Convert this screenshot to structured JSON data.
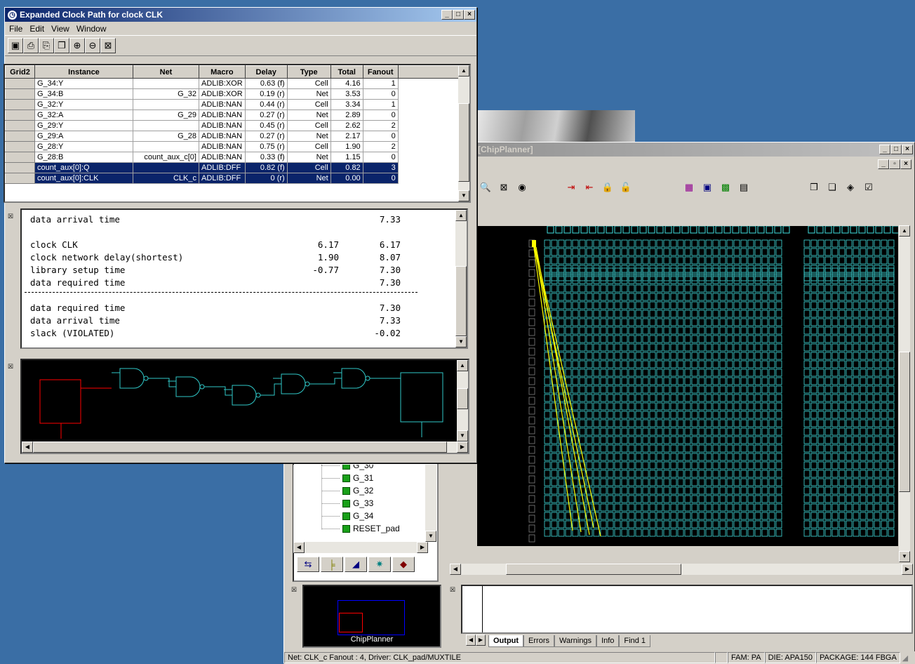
{
  "timing_window": {
    "title": "Expanded Clock Path for clock CLK",
    "menu": [
      "File",
      "Edit",
      "View",
      "Window"
    ],
    "toolbar_icons": [
      "save-icon",
      "print-icon",
      "print-preview-icon",
      "copy-icon",
      "zoom-in-icon",
      "zoom-out-icon",
      "zoom-fit-icon"
    ],
    "columns": [
      "Grid2",
      "Instance",
      "Net",
      "Macro",
      "Delay",
      "Type",
      "Total",
      "Fanout"
    ],
    "rows": [
      {
        "instance": "G_34:Y",
        "net": "",
        "macro": "ADLIB:XOR",
        "delay": "0.63 (f)",
        "type": "Cell",
        "total": "4.16",
        "fanout": "1"
      },
      {
        "instance": "G_34:B",
        "net": "G_32",
        "macro": "ADLIB:XOR",
        "delay": "0.19 (r)",
        "type": "Net",
        "total": "3.53",
        "fanout": "0"
      },
      {
        "instance": "G_32:Y",
        "net": "",
        "macro": "ADLIB:NAN",
        "delay": "0.44 (r)",
        "type": "Cell",
        "total": "3.34",
        "fanout": "1"
      },
      {
        "instance": "G_32:A",
        "net": "G_29",
        "macro": "ADLIB:NAN",
        "delay": "0.27 (r)",
        "type": "Net",
        "total": "2.89",
        "fanout": "0"
      },
      {
        "instance": "G_29:Y",
        "net": "",
        "macro": "ADLIB:NAN",
        "delay": "0.45 (r)",
        "type": "Cell",
        "total": "2.62",
        "fanout": "2"
      },
      {
        "instance": "G_29:A",
        "net": "G_28",
        "macro": "ADLIB:NAN",
        "delay": "0.27 (r)",
        "type": "Net",
        "total": "2.17",
        "fanout": "0"
      },
      {
        "instance": "G_28:Y",
        "net": "",
        "macro": "ADLIB:NAN",
        "delay": "0.75 (r)",
        "type": "Cell",
        "total": "1.90",
        "fanout": "2"
      },
      {
        "instance": "G_28:B",
        "net": "count_aux_c[0]",
        "macro": "ADLIB:NAN",
        "delay": "0.33 (f)",
        "type": "Net",
        "total": "1.15",
        "fanout": "0"
      },
      {
        "instance": "count_aux[0]:Q",
        "net": "",
        "macro": "ADLIB:DFF",
        "delay": "0.82 (f)",
        "type": "Cell",
        "total": "0.82",
        "fanout": "3",
        "selected": true
      },
      {
        "instance": "count_aux[0]:CLK",
        "net": "CLK_c",
        "macro": "ADLIB:DFF",
        "delay": "0 (r)",
        "type": "Net",
        "total": "0.00",
        "fanout": "0",
        "selected": true
      }
    ],
    "report": [
      {
        "label": "data arrival time",
        "v1": "",
        "v2": "7.33"
      },
      {
        "label": "",
        "v1": "",
        "v2": ""
      },
      {
        "label": "clock CLK",
        "v1": "6.17",
        "v2": "6.17"
      },
      {
        "label": "clock network delay(shortest)",
        "v1": "1.90",
        "v2": "8.07"
      },
      {
        "label": "library setup time",
        "v1": "-0.77",
        "v2": "7.30"
      },
      {
        "label": "data required time",
        "v1": "",
        "v2": "7.30"
      },
      {
        "label": "separator",
        "v1": "",
        "v2": ""
      },
      {
        "label": "data required time",
        "v1": "",
        "v2": "7.30"
      },
      {
        "label": "data arrival time",
        "v1": "",
        "v2": "7.33"
      },
      {
        "label": "slack (VIOLATED)",
        "v1": "",
        "v2": "-0.02"
      }
    ]
  },
  "chipplanner": {
    "title": "[ChipPlanner]",
    "panel_label": "ChipPlanner"
  },
  "tree": {
    "items": [
      "G_30",
      "G_31",
      "G_32",
      "G_33",
      "G_34",
      "RESET_pad"
    ]
  },
  "output_tabs": [
    "Output",
    "Errors",
    "Warnings",
    "Info",
    "Find 1"
  ],
  "status": {
    "message": "Net: CLK_c Fanout : 4, Driver: CLK_pad/MUXTILE",
    "fam": "FAM: PA",
    "die": "DIE: APA150",
    "package": "PACKAGE: 144 FBGA"
  },
  "colors": {
    "desktop": "#3a6ea5",
    "title_active": "#0a246a",
    "selection": "#0a246a",
    "grid_lines": "#40e0e0",
    "path": "#ffff00",
    "register": "#ff0000"
  }
}
